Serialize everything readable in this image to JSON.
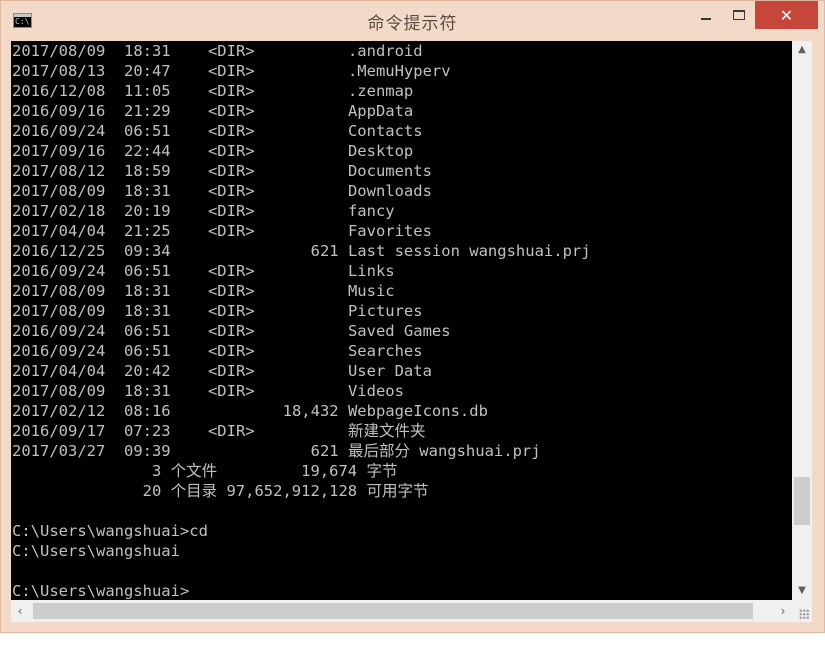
{
  "window": {
    "title": "命令提示符",
    "icon": "cmd-icon",
    "icon_text": "C:\\",
    "controls": {
      "close_glyph": "✕"
    }
  },
  "console": {
    "lines": [
      "2017/08/09  18:31    <DIR>          .android",
      "2017/08/13  20:47    <DIR>          .MemuHyperv",
      "2016/12/08  11:05    <DIR>          .zenmap",
      "2016/09/16  21:29    <DIR>          AppData",
      "2016/09/24  06:51    <DIR>          Contacts",
      "2017/09/16  22:44    <DIR>          Desktop",
      "2017/08/12  18:59    <DIR>          Documents",
      "2017/08/09  18:31    <DIR>          Downloads",
      "2017/02/18  20:19    <DIR>          fancy",
      "2017/04/04  21:25    <DIR>          Favorites",
      "2016/12/25  09:34               621 Last session wangshuai.prj",
      "2016/09/24  06:51    <DIR>          Links",
      "2017/08/09  18:31    <DIR>          Music",
      "2017/08/09  18:31    <DIR>          Pictures",
      "2016/09/24  06:51    <DIR>          Saved Games",
      "2016/09/24  06:51    <DIR>          Searches",
      "2017/04/04  20:42    <DIR>          User Data",
      "2017/08/09  18:31    <DIR>          Videos",
      "2017/02/12  08:16            18,432 WebpageIcons.db",
      "2016/09/17  07:23    <DIR>          新建文件夹",
      "2017/03/27  09:39               621 最后部分 wangshuai.prj",
      "               3 个文件         19,674 字节",
      "              20 个目录 97,652,912,128 可用字节",
      "",
      "C:\\Users\\wangshuai>cd",
      "C:\\Users\\wangshuai",
      "",
      "C:\\Users\\wangshuai>"
    ]
  },
  "scrollbars": {
    "up_glyph": "▲",
    "down_glyph": "▼",
    "left_glyph": "‹",
    "right_glyph": "›"
  }
}
